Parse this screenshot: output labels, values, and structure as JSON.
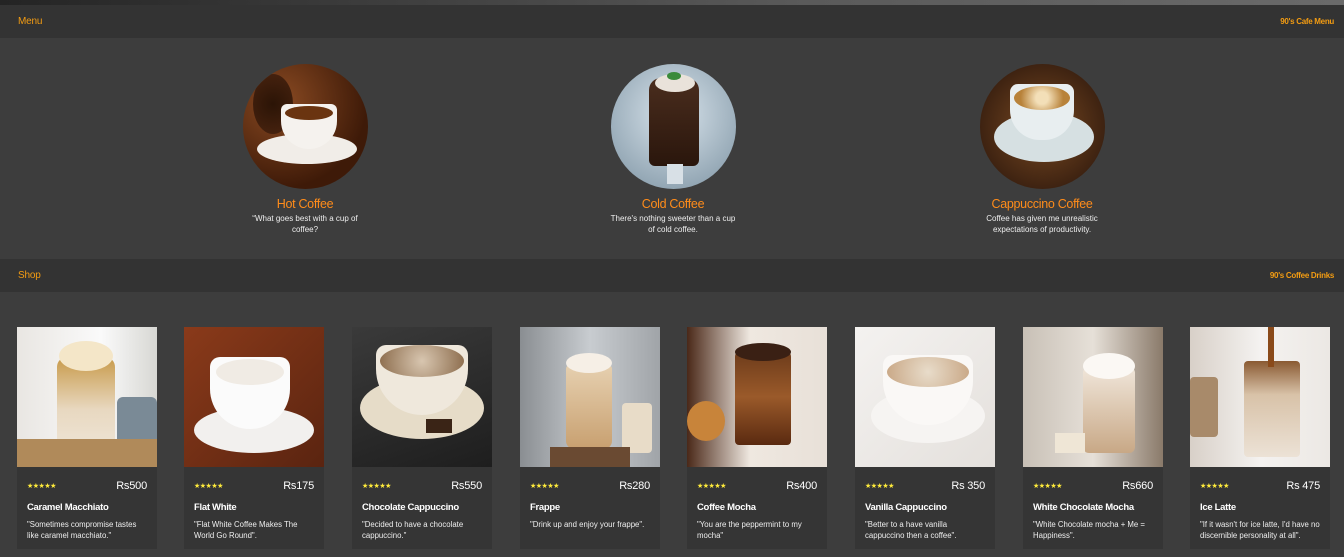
{
  "menu_bar": {
    "title": "Menu",
    "right": "90's Cafe Menu"
  },
  "categories": [
    {
      "title": "Hot Coffee",
      "desc": "“What goes best with a cup of coffee?"
    },
    {
      "title": "Cold Coffee",
      "desc": "There's nothing sweeter than a cup of cold coffee."
    },
    {
      "title": "Cappuccino Coffee",
      "desc": "Coffee has given me unrealistic expectations of productivity."
    }
  ],
  "shop_bar": {
    "title": "Shop",
    "right": "90's Coffee Drinks"
  },
  "products": [
    {
      "name": "Caramel Macchiato",
      "price": "Rs500",
      "stars": "★★★★★",
      "quote": "\"Sometimes compromise tastes like caramel macchiato.\""
    },
    {
      "name": "Flat White",
      "price": "Rs175",
      "stars": "★★★★★",
      "quote": "\"Flat White Coffee Makes The World Go Round\"."
    },
    {
      "name": "Chocolate Cappuccino",
      "price": "Rs550",
      "stars": "★★★★★",
      "quote": "\"Decided to have a chocolate cappuccino.\""
    },
    {
      "name": "Frappe",
      "price": "Rs280",
      "stars": "★★★★★",
      "quote": "\"Drink up and enjoy your frappe\"."
    },
    {
      "name": "Coffee Mocha",
      "price": "Rs400",
      "stars": "★★★★★",
      "quote": "\"You are the peppermint to my mocha\""
    },
    {
      "name": "Vanilla Cappuccino",
      "price": "Rs 350",
      "stars": "★★★★★",
      "quote": "\"Better to a have vanilla cappuccino then a coffee\"."
    },
    {
      "name": "White Chocolate Mocha",
      "price": "Rs660",
      "stars": "★★★★★",
      "quote": "\"White Chocolate mocha + Me = Happiness\"."
    },
    {
      "name": "Ice Latte",
      "price": "Rs 475",
      "stars": "★★★★★",
      "quote": "\"If it wasn't for ice latte, I'd have no discernible personality at all\"."
    }
  ],
  "colors": {
    "accent": "#f39c12",
    "background": "#3d3d3d",
    "bar": "#333333",
    "star": "#ffeb3b"
  }
}
